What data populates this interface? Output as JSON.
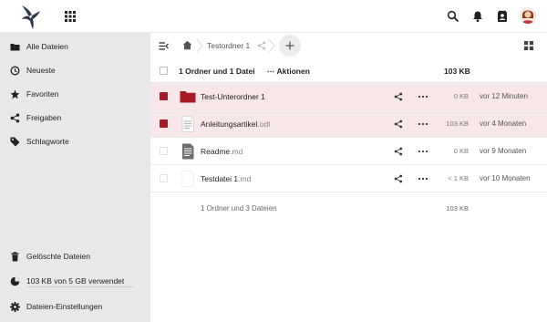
{
  "header": {
    "logo_icon": "hummingbird-logo-icon",
    "apps_icon": "app-grid-icon",
    "search_icon": "search-icon",
    "notifications_icon": "bell-icon",
    "contacts_icon": "contacts-icon",
    "avatar_icon": "user-avatar"
  },
  "sidebar": {
    "items": [
      {
        "label": "Alle Dateien",
        "icon": "folder-icon"
      },
      {
        "label": "Neueste",
        "icon": "clock-icon"
      },
      {
        "label": "Favoriten",
        "icon": "star-icon"
      },
      {
        "label": "Freigaben",
        "icon": "share-icon"
      },
      {
        "label": "Schlagworte",
        "icon": "tag-icon"
      }
    ],
    "trash_label": "Gelöschte Dateien",
    "quota_label": "103 KB von 5 GB verwendet",
    "settings_label": "Dateien-Einstellungen"
  },
  "breadcrumb": {
    "folder": "Testordner 1",
    "add_label": "+"
  },
  "table": {
    "selection_count": "1 Ordner und 1 Datei",
    "actions_label": "Aktionen",
    "total_size": "103 KB",
    "rows": [
      {
        "name": "Test-Unterordner 1",
        "ext": "",
        "size": "0 KB",
        "date": "vor 12 Minuten",
        "type": "folder",
        "selected": true
      },
      {
        "name": "Anleitungsartikel",
        "ext": ".odt",
        "size": "103 KB",
        "date": "vor 4 Monaten",
        "type": "document",
        "selected": true
      },
      {
        "name": "Readme",
        "ext": ".md",
        "size": "0 KB",
        "date": "vor 9 Monaten",
        "type": "text",
        "selected": false
      },
      {
        "name": "Testdatei 1",
        "ext": ".md",
        "size": "< 1 KB",
        "date": "vor 10 Monaten",
        "type": "blank",
        "selected": false
      }
    ],
    "summary": "1 Ordner und 3 Dateien",
    "summary_size": "103 KB"
  },
  "colors": {
    "accent": "#a51a25",
    "selected_row": "#f7e7e8",
    "sidebar_bg": "#e8e8e8"
  }
}
